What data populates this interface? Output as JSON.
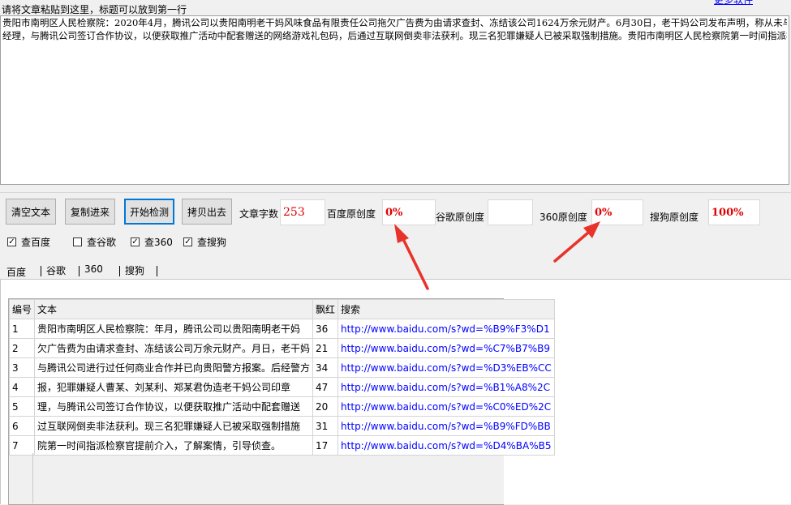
{
  "instruction": "请将文章粘贴到这里，标题可以放到第一行",
  "top_link": "更多软件",
  "article": {
    "line1": "贵阳市南明区人民检察院：2020年4月，腾讯公司以贵阳南明老干妈风味食品有限责任公司拖欠广告费为由请求查封、冻结该公司1624万余元财产。6月30日，老干妈公司发布声明，称从未与腾讯公司进行过任何商业合作并已向贵阳警方报案。",
    "line2": "经理，与腾讯公司签订合作协议，以便获取推广活动中配套赠送的网络游戏礼包码，后通过互联网倒卖非法获利。现三名犯罪嫌疑人已被采取强制措施。贵阳市南明区人民检察院第一时间指派检察官提前介入，了解案情，引导侦查。"
  },
  "toolbar": {
    "clear": "清空文本",
    "paste": "复制进来",
    "start": "开始检测",
    "copy_out": "拷贝出去",
    "word_count_label": "文章字数",
    "word_count": "253",
    "baidu_label": "百度原创度",
    "baidu_value": "0%",
    "google_label": "谷歌原创度",
    "google_value": "",
    "s360_label": "360原创度",
    "s360_value": "0%",
    "sogou_label": "搜狗原创度",
    "sogou_value": "100%"
  },
  "checks": [
    {
      "label": "查百度",
      "checked": true
    },
    {
      "label": "查谷歌",
      "checked": false
    },
    {
      "label": "查360",
      "checked": true
    },
    {
      "label": "查搜狗",
      "checked": true
    }
  ],
  "tabs": [
    "百度",
    "谷歌",
    "360",
    "搜狗"
  ],
  "table": {
    "headers": [
      "编号",
      "文本",
      "飘红",
      "搜索"
    ],
    "rows": [
      [
        "1",
        "贵阳市南明区人民检察院：年月，腾讯公司以贵阳南明老干妈",
        "36",
        "http://www.baidu.com/s?wd=%B9%F3%D1"
      ],
      [
        "2",
        "欠广告费为由请求查封、冻结该公司万余元财产。月日，老干妈",
        "21",
        "http://www.baidu.com/s?wd=%C7%B7%B9"
      ],
      [
        "3",
        "与腾讯公司进行过任何商业合作并已向贵阳警方报案。后经警方",
        "34",
        "http://www.baidu.com/s?wd=%D3%EB%CC"
      ],
      [
        "4",
        "报，犯罪嫌疑人曹某、刘某利、郑某君伪造老干妈公司印章",
        "47",
        "http://www.baidu.com/s?wd=%B1%A8%2C"
      ],
      [
        "5",
        "理，与腾讯公司签订合作协议，以便获取推广活动中配套赠送",
        "20",
        "http://www.baidu.com/s?wd=%C0%ED%2C"
      ],
      [
        "6",
        "过互联网倒卖非法获利。现三名犯罪嫌疑人已被采取强制措施",
        "31",
        "http://www.baidu.com/s?wd=%B9%FD%BB"
      ],
      [
        "7",
        "院第一时间指派检察官提前介入，了解案情，引导侦查。",
        "17",
        "http://www.baidu.com/s?wd=%D4%BA%B5"
      ]
    ]
  },
  "icons": {
    "arrow": "red-arrow-icon"
  },
  "colors": {
    "value_red": "#e00000",
    "link_blue": "#0000ff",
    "arrow_red": "#e8332b"
  }
}
